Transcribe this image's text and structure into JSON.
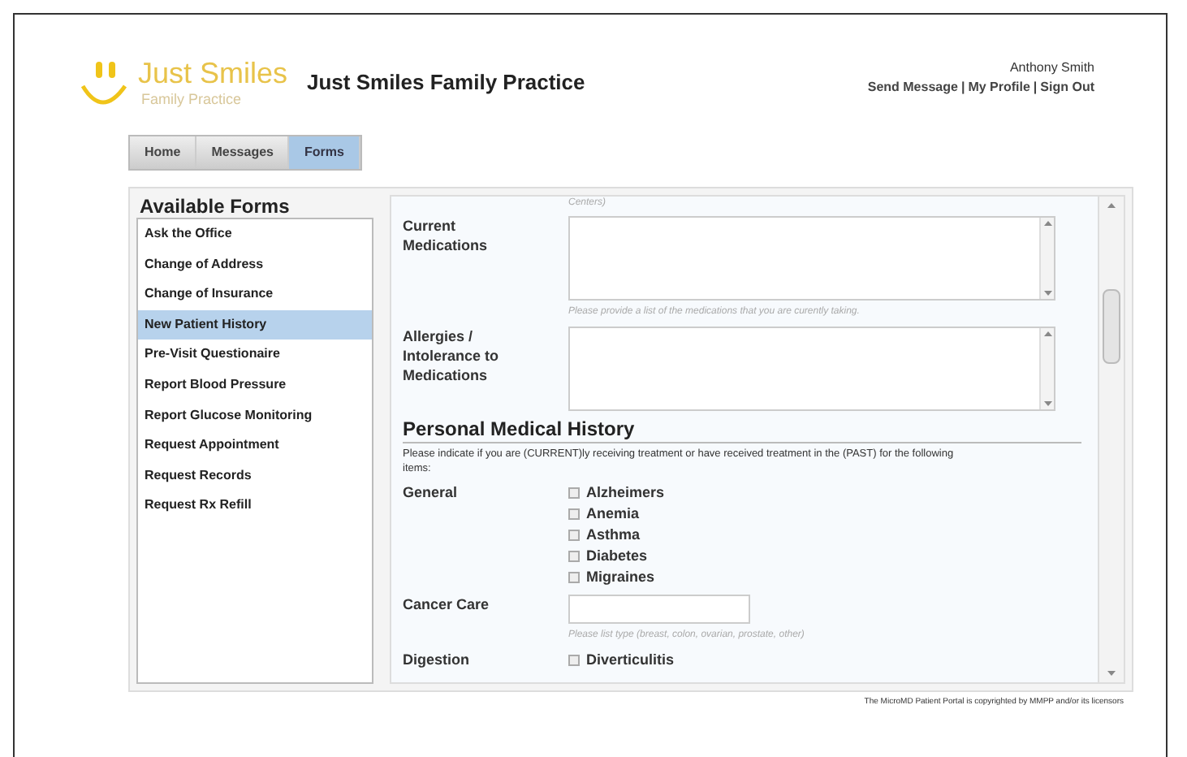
{
  "logo": {
    "name": "Just Smiles",
    "tagline": "Family Practice"
  },
  "site_title": "Just Smiles Family Practice",
  "user": {
    "name": "Anthony Smith",
    "links": [
      "Send Message",
      "My Profile",
      "Sign Out"
    ],
    "separator": "|"
  },
  "nav_tabs": [
    {
      "label": "Home",
      "selected": false
    },
    {
      "label": "Messages",
      "selected": false
    },
    {
      "label": "Forms",
      "selected": true
    }
  ],
  "sidebar": {
    "title": "Available Forms",
    "items": [
      {
        "label": "Ask the Office",
        "selected": false
      },
      {
        "label": "Change of Address",
        "selected": false
      },
      {
        "label": "Change of Insurance",
        "selected": false
      },
      {
        "label": "New Patient History",
        "selected": true
      },
      {
        "label": "Pre-Visit Questionaire",
        "selected": false
      },
      {
        "label": "Report Blood Pressure",
        "selected": false
      },
      {
        "label": "Report Glucose Monitoring",
        "selected": false
      },
      {
        "label": "Request Appointment",
        "selected": false
      },
      {
        "label": "Request Records",
        "selected": false
      },
      {
        "label": "Request Rx Refill",
        "selected": false
      }
    ]
  },
  "form": {
    "top_hint": "Centers)",
    "fields": [
      {
        "label": "Current Medications",
        "hint": "Please provide a list of the medications that you are curently taking."
      },
      {
        "label": "Allergies / Intolerance to Medications"
      }
    ],
    "section": {
      "title": "Personal Medical History",
      "intro": "Please indicate if you are (CURRENT)ly receiving treatment or have received treatment in the (PAST) for the following items:",
      "groups": [
        {
          "label": "General",
          "kind": "checkboxes",
          "options": [
            {
              "label": "Alzheimers",
              "checked": false
            },
            {
              "label": "Anemia",
              "checked": false
            },
            {
              "label": "Asthma",
              "checked": false
            },
            {
              "label": "Diabetes",
              "checked": false
            },
            {
              "label": "Migraines",
              "checked": false
            }
          ]
        },
        {
          "label": "Cancer Care",
          "kind": "text",
          "hint": "Please list type (breast, colon, ovarian, prostate, other)"
        },
        {
          "label": "Digestion",
          "kind": "checkboxes",
          "options": [
            {
              "label": "Diverticulitis",
              "checked": false
            }
          ]
        }
      ]
    }
  },
  "footer": "The MicroMD Patient Portal is copyrighted by MMPP and/or its licensors"
}
